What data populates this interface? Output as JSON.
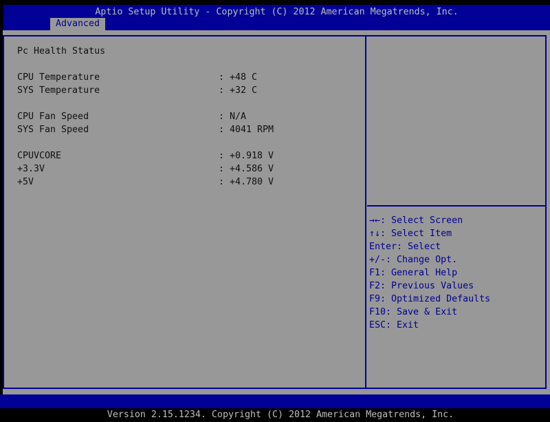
{
  "title_bar": {
    "text": "Aptio Setup Utility - Copyright (C) 2012 American Megatrends, Inc."
  },
  "tab_bar": {
    "tabs": [
      {
        "label": "Advanced",
        "active": true
      }
    ]
  },
  "main": {
    "section_title": "Pc Health Status",
    "value_separator": ":",
    "groups": [
      {
        "rows": [
          {
            "label": "CPU Temperature",
            "value": "+48 C"
          },
          {
            "label": "SYS Temperature",
            "value": "+32 C"
          }
        ]
      },
      {
        "rows": [
          {
            "label": "CPU Fan Speed",
            "value": "N/A"
          },
          {
            "label": "SYS Fan Speed",
            "value": "4041 RPM"
          }
        ]
      },
      {
        "rows": [
          {
            "label": "CPUVCORE",
            "value": "+0.918 V"
          },
          {
            "label": "+3.3V",
            "value": "+4.586 V"
          },
          {
            "label": "+5V",
            "value": "+4.780 V"
          }
        ]
      }
    ]
  },
  "help_panel": {
    "items": [
      "→←: Select Screen",
      "↑↓: Select Item",
      "Enter: Select",
      "+/-: Change Opt.",
      "F1: General Help",
      "F2: Previous Values",
      "F9: Optimized Defaults",
      "F10: Save & Exit",
      "ESC: Exit"
    ]
  },
  "footer": {
    "text": "Version 2.15.1234. Copyright (C) 2012 American Megatrends, Inc."
  },
  "colors": {
    "accent_blue": "#000096",
    "background_gray": "#989898",
    "bar_text_gray": "#BEBEBE",
    "body_text": "#101010",
    "screen_border_black": "#000000"
  }
}
